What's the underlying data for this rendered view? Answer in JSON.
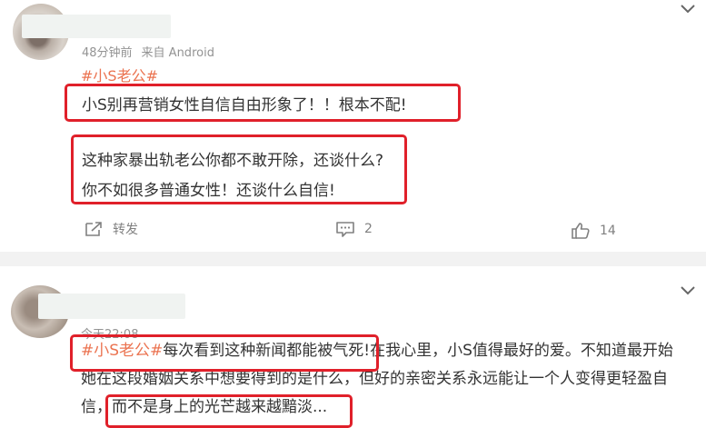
{
  "post1": {
    "meta_time": "48分钟前",
    "meta_source": "来自 Android",
    "topic": "#小S老公#",
    "line1": "小S别再营销女性自信自由形象了！！根本不配!",
    "line2": "这种家暴出轨老公你都不敢开除，还谈什么?",
    "line3": "你不如很多普通女性！还谈什么自信!",
    "actions": {
      "forward_label": "转发",
      "comment_count": "2",
      "like_count": "14"
    }
  },
  "post2": {
    "meta_time": "今天22:08",
    "topic": "#小S老公#",
    "line1_rest": "每次看到这种新闻都能被气死!",
    "line1_tail": "在我心里，小S值得最好的爱。不知道最开始",
    "line2": "她在这段婚姻关系中想要得到的是什么，但好的亲密关系永远能让一个人变得更轻盈自",
    "line3_a": "信，",
    "line3_b": "而不是身上的光芒越来越黯淡..."
  },
  "colors": {
    "topic": "#eb7350",
    "highlight_box": "#e0202a",
    "meta_text": "#939393"
  },
  "icons": [
    "chevron-down-icon",
    "forward-icon",
    "comment-icon",
    "like-icon"
  ]
}
